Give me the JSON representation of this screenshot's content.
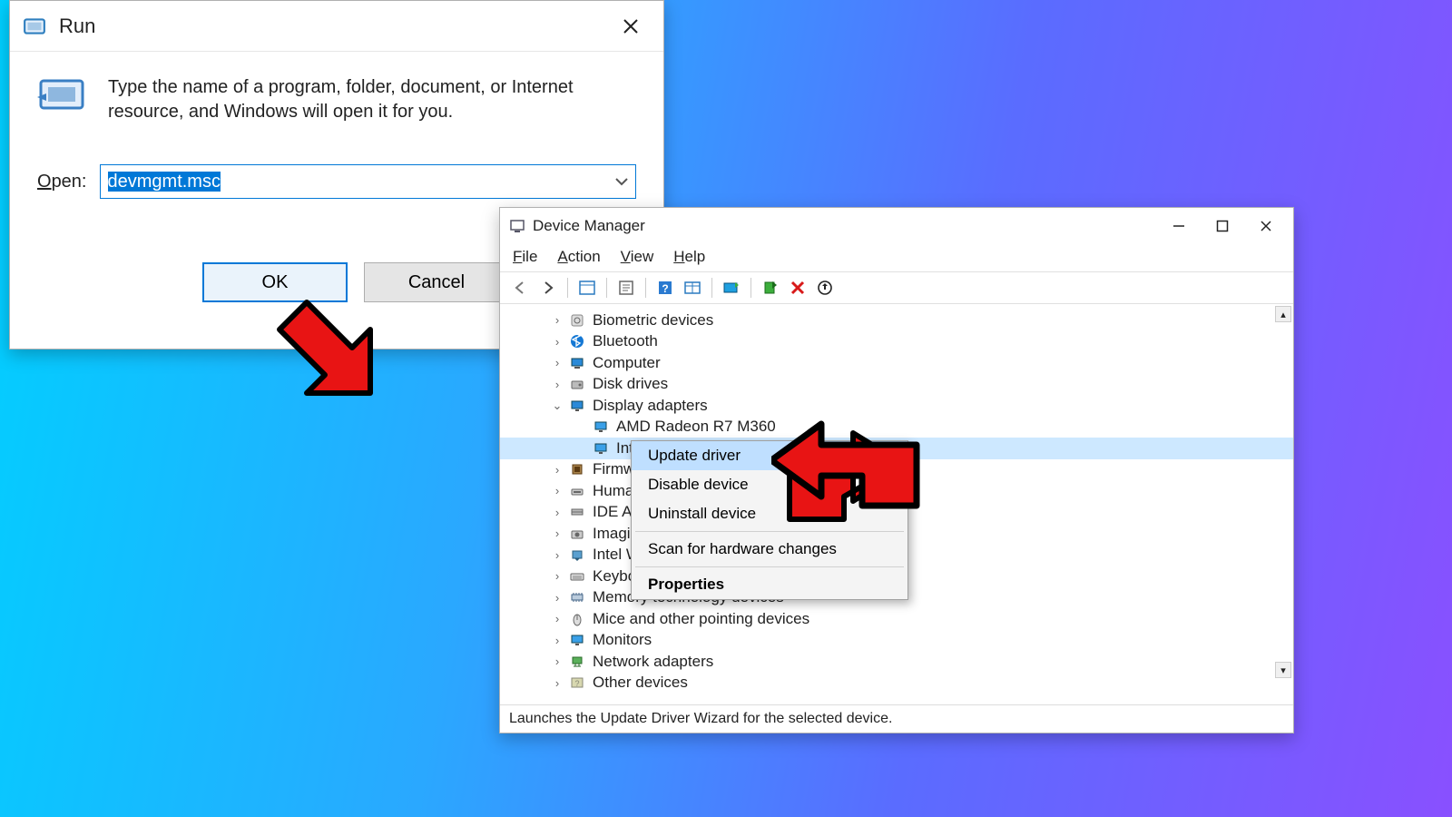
{
  "run": {
    "title": "Run",
    "desc": "Type the name of a program, folder, document, or Internet resource, and Windows will open it for you.",
    "open_label": "Open:",
    "open_value": "devmgmt.msc",
    "ok": "OK",
    "cancel": "Cancel"
  },
  "devmgr": {
    "title": "Device Manager",
    "menu": {
      "file": "File",
      "action": "Action",
      "view": "View",
      "help": "Help"
    },
    "status": "Launches the Update Driver Wizard for the selected device.",
    "tree": {
      "biometric": "Biometric devices",
      "bluetooth": "Bluetooth",
      "computer": "Computer",
      "disk": "Disk drives",
      "display": "Display adapters",
      "amd": "AMD Radeon R7 M360",
      "intel_gfx": "Intel(R",
      "firmware": "Firmware",
      "hid": "Human I",
      "ide": "IDE ATA/A",
      "imaging": "Imaging c",
      "wiusb": "Intel WiUS",
      "keyboards": "Keyboard",
      "memory": "Memory technology devices",
      "mice": "Mice and other pointing devices",
      "monitors": "Monitors",
      "network": "Network adapters",
      "other": "Other devices"
    }
  },
  "ctx": {
    "update": "Update driver",
    "disable": "Disable device",
    "uninstall": "Uninstall device",
    "scan": "Scan for hardware changes",
    "props": "Properties"
  },
  "icons": {
    "run_small": "run-dialog-icon",
    "run_big": "run-big-icon"
  }
}
